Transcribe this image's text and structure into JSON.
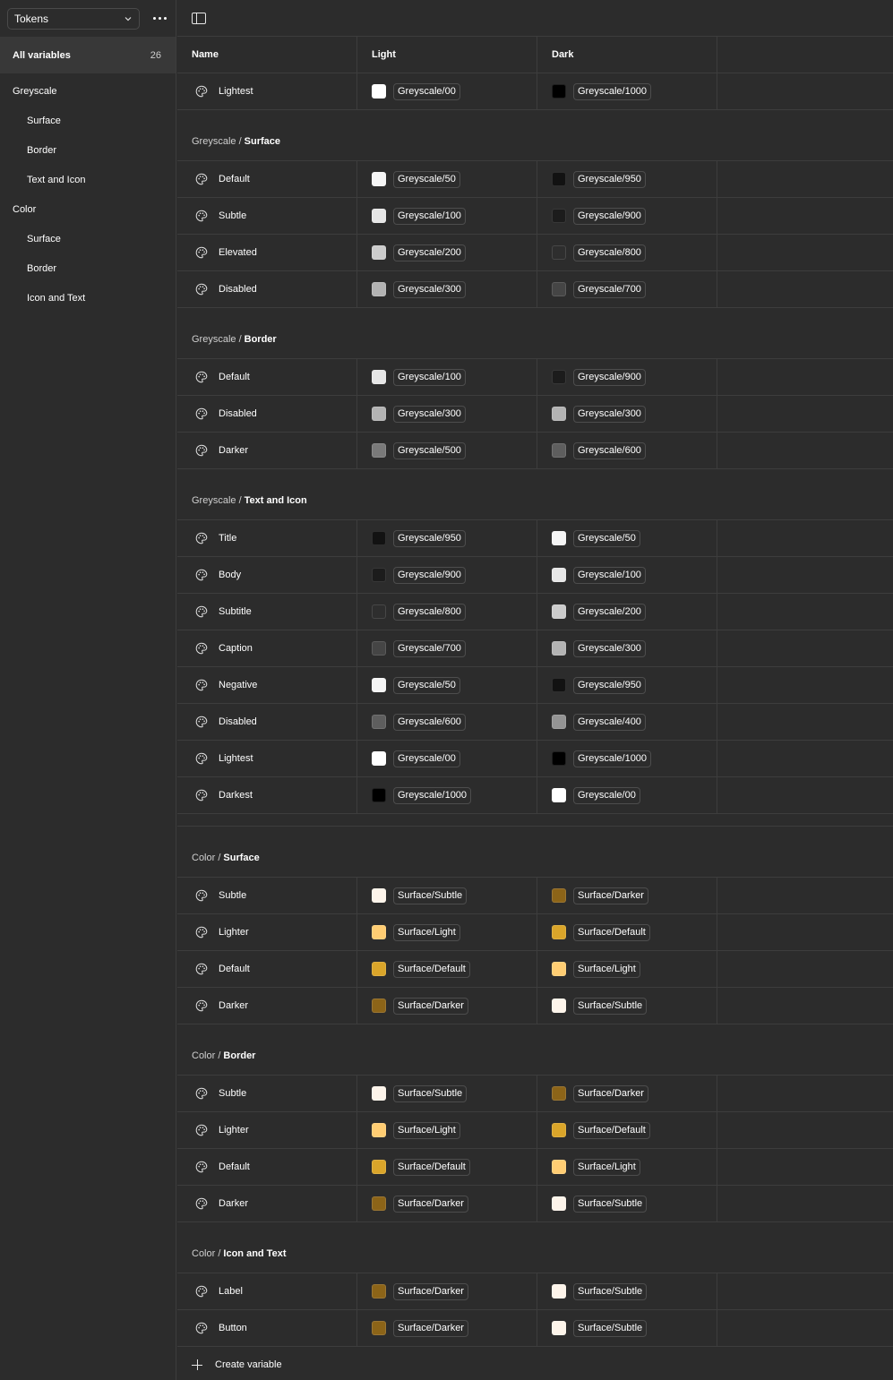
{
  "sidebar": {
    "collection": "Tokens",
    "all_label": "All variables",
    "all_count": "26",
    "groups": [
      {
        "label": "Greyscale",
        "items": [
          "Surface",
          "Border",
          "Text and Icon"
        ]
      },
      {
        "label": "Color",
        "items": [
          "Surface",
          "Border",
          "Icon and Text"
        ]
      }
    ]
  },
  "table": {
    "headers": {
      "name": "Name",
      "light": "Light",
      "dark": "Dark"
    },
    "groups": [
      {
        "prefix": "",
        "title": "",
        "rows": [
          {
            "name": "Lightest",
            "light": {
              "label": "Greyscale/00",
              "color": "#ffffff"
            },
            "dark": {
              "label": "Greyscale/1000",
              "color": "#000000"
            }
          }
        ]
      },
      {
        "prefix": "Greyscale /",
        "title": "Surface",
        "rows": [
          {
            "name": "Default",
            "light": {
              "label": "Greyscale/50",
              "color": "#f5f5f5"
            },
            "dark": {
              "label": "Greyscale/950",
              "color": "#121212"
            }
          },
          {
            "name": "Subtle",
            "light": {
              "label": "Greyscale/100",
              "color": "#e6e6e6"
            },
            "dark": {
              "label": "Greyscale/900",
              "color": "#1c1c1c"
            }
          },
          {
            "name": "Elevated",
            "light": {
              "label": "Greyscale/200",
              "color": "#cccccc"
            },
            "dark": {
              "label": "Greyscale/800",
              "color": "#2e2e2e"
            }
          },
          {
            "name": "Disabled",
            "light": {
              "label": "Greyscale/300",
              "color": "#b3b3b3"
            },
            "dark": {
              "label": "Greyscale/700",
              "color": "#454545"
            }
          }
        ]
      },
      {
        "prefix": "Greyscale /",
        "title": "Border",
        "rows": [
          {
            "name": "Default",
            "light": {
              "label": "Greyscale/100",
              "color": "#e6e6e6"
            },
            "dark": {
              "label": "Greyscale/900",
              "color": "#1c1c1c"
            }
          },
          {
            "name": "Disabled",
            "light": {
              "label": "Greyscale/300",
              "color": "#b3b3b3"
            },
            "dark": {
              "label": "Greyscale/300",
              "color": "#b3b3b3"
            }
          },
          {
            "name": "Darker",
            "light": {
              "label": "Greyscale/500",
              "color": "#7a7a7a"
            },
            "dark": {
              "label": "Greyscale/600",
              "color": "#5e5e5e"
            }
          }
        ]
      },
      {
        "prefix": "Greyscale /",
        "title": "Text and Icon",
        "rows": [
          {
            "name": "Title",
            "light": {
              "label": "Greyscale/950",
              "color": "#121212"
            },
            "dark": {
              "label": "Greyscale/50",
              "color": "#f5f5f5"
            }
          },
          {
            "name": "Body",
            "light": {
              "label": "Greyscale/900",
              "color": "#1c1c1c"
            },
            "dark": {
              "label": "Greyscale/100",
              "color": "#e6e6e6"
            }
          },
          {
            "name": "Subtitle",
            "light": {
              "label": "Greyscale/800",
              "color": "#2e2e2e"
            },
            "dark": {
              "label": "Greyscale/200",
              "color": "#cccccc"
            }
          },
          {
            "name": "Caption",
            "light": {
              "label": "Greyscale/700",
              "color": "#454545"
            },
            "dark": {
              "label": "Greyscale/300",
              "color": "#b3b3b3"
            }
          },
          {
            "name": "Negative",
            "light": {
              "label": "Greyscale/50",
              "color": "#f5f5f5"
            },
            "dark": {
              "label": "Greyscale/950",
              "color": "#121212"
            }
          },
          {
            "name": "Disabled",
            "light": {
              "label": "Greyscale/600",
              "color": "#5e5e5e"
            },
            "dark": {
              "label": "Greyscale/400",
              "color": "#949494"
            }
          },
          {
            "name": "Lightest",
            "light": {
              "label": "Greyscale/00",
              "color": "#ffffff"
            },
            "dark": {
              "label": "Greyscale/1000",
              "color": "#000000"
            }
          },
          {
            "name": "Darkest",
            "light": {
              "label": "Greyscale/1000",
              "color": "#000000"
            },
            "dark": {
              "label": "Greyscale/00",
              "color": "#ffffff"
            }
          }
        ]
      },
      {
        "prefix": "Color /",
        "title": "Surface",
        "gap_before": true,
        "rows": [
          {
            "name": "Subtle",
            "light": {
              "label": "Surface/Subtle",
              "color": "#fdf4ea"
            },
            "dark": {
              "label": "Surface/Darker",
              "color": "#8c6418"
            }
          },
          {
            "name": "Lighter",
            "light": {
              "label": "Surface/Light",
              "color": "#ffcd73"
            },
            "dark": {
              "label": "Surface/Default",
              "color": "#daa52a"
            }
          },
          {
            "name": "Default",
            "light": {
              "label": "Surface/Default",
              "color": "#daa52a"
            },
            "dark": {
              "label": "Surface/Light",
              "color": "#ffcd73"
            }
          },
          {
            "name": "Darker",
            "light": {
              "label": "Surface/Darker",
              "color": "#8c6418"
            },
            "dark": {
              "label": "Surface/Subtle",
              "color": "#fdf4ea"
            }
          }
        ]
      },
      {
        "prefix": "Color /",
        "title": "Border",
        "rows": [
          {
            "name": "Subtle",
            "light": {
              "label": "Surface/Subtle",
              "color": "#fdf4ea"
            },
            "dark": {
              "label": "Surface/Darker",
              "color": "#8c6418"
            }
          },
          {
            "name": "Lighter",
            "light": {
              "label": "Surface/Light",
              "color": "#ffcd73"
            },
            "dark": {
              "label": "Surface/Default",
              "color": "#daa52a"
            }
          },
          {
            "name": "Default",
            "light": {
              "label": "Surface/Default",
              "color": "#daa52a"
            },
            "dark": {
              "label": "Surface/Light",
              "color": "#ffcd73"
            }
          },
          {
            "name": "Darker",
            "light": {
              "label": "Surface/Darker",
              "color": "#8c6418"
            },
            "dark": {
              "label": "Surface/Subtle",
              "color": "#fdf4ea"
            }
          }
        ]
      },
      {
        "prefix": "Color /",
        "title": "Icon and Text",
        "rows": [
          {
            "name": "Label",
            "light": {
              "label": "Surface/Darker",
              "color": "#8c6418"
            },
            "dark": {
              "label": "Surface/Subtle",
              "color": "#fdf4ea"
            }
          },
          {
            "name": "Button",
            "light": {
              "label": "Surface/Darker",
              "color": "#8c6418"
            },
            "dark": {
              "label": "Surface/Subtle",
              "color": "#fdf4ea"
            }
          }
        ]
      }
    ],
    "create_label": "Create variable"
  }
}
